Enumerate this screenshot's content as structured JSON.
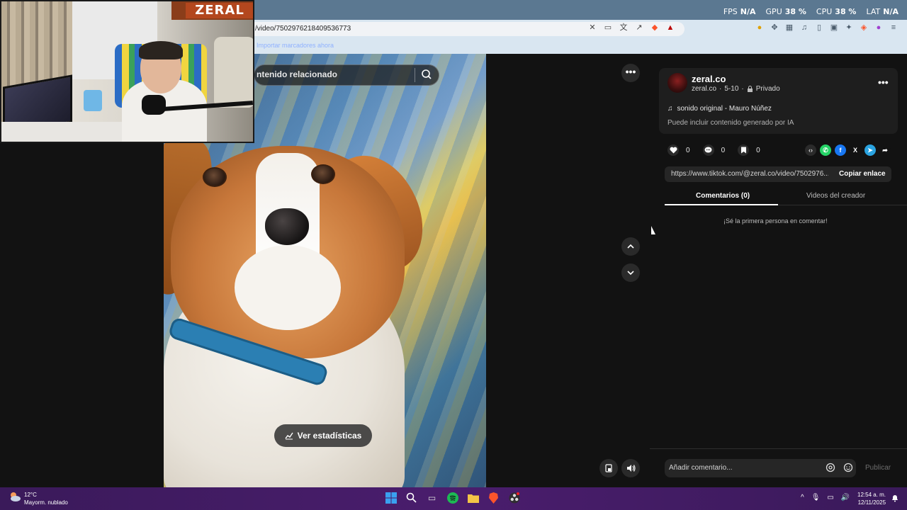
{
  "overlay": {
    "stats": [
      {
        "label": "FPS",
        "value": "N/A"
      },
      {
        "label": "GPU",
        "value": "38 %"
      },
      {
        "label": "CPU",
        "value": "38 %"
      },
      {
        "label": "LAT",
        "value": "N/A"
      }
    ]
  },
  "browser": {
    "url": "/video/7502976218409536773",
    "bookmark_text": "Importar marcadores ahora"
  },
  "video": {
    "search_placeholder": "ntenido relacionado",
    "stats_button": "Ver estadísticas"
  },
  "author": {
    "name": "zeral.co",
    "handle": "zeral.co",
    "date": "5-10",
    "separator": "·",
    "privacy": "Privado",
    "sound": "sonido original - Mauro Núñez",
    "ai_note": "Puede incluir contenido generado por IA"
  },
  "actions": {
    "likes": "0",
    "comments": "0",
    "saves": "0"
  },
  "share": {
    "link": "https://www.tiktok.com/@zeral.co/video/7502976...",
    "copy_label": "Copiar enlace"
  },
  "tabs": {
    "comments": "Comentarios (0)",
    "creator_videos": "Videos del creador"
  },
  "comments": {
    "empty": "¡Sé la primera persona en comentar!",
    "placeholder": "Añadir comentario...",
    "publish": "Publicar"
  },
  "webcam": {
    "logo": "ZERAL"
  },
  "taskbar": {
    "temperature": "12°C",
    "weather": "Mayorm. nublado",
    "time": "12:54 a. m.",
    "date": "12/11/2025"
  },
  "colors": {
    "taskbar": "#4a1d6d",
    "panel": "#121212",
    "brave": "#fb542b"
  }
}
